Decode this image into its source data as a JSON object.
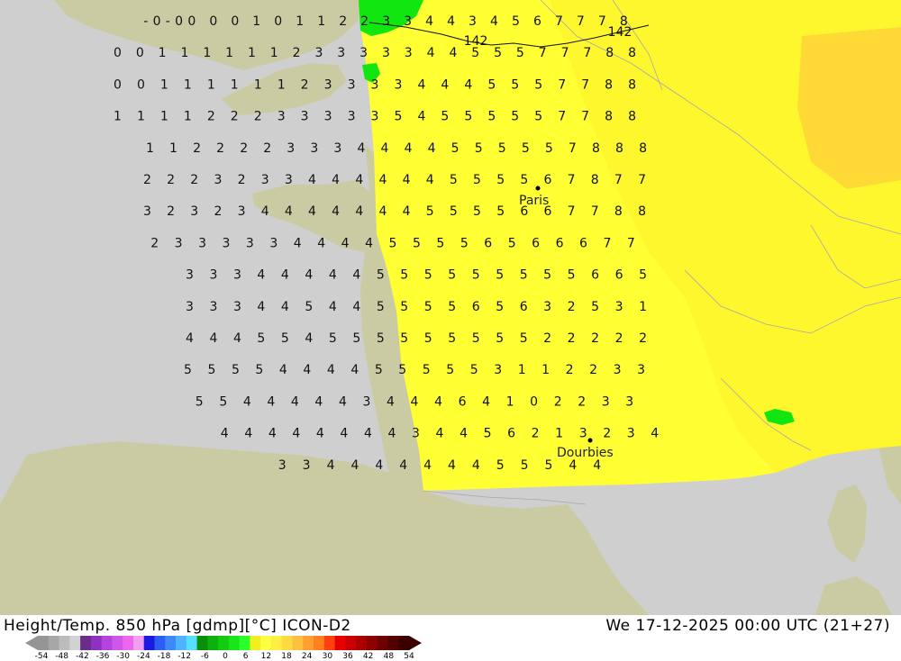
{
  "header": {
    "title_left": "Height/Temp. 850 hPa [gdmp][°C] ICON-D2",
    "title_right": "We 17-12-2025 00:00 UTC (21+27)"
  },
  "colors": {
    "sea": "#cfcfcf",
    "land": "#cbcba3",
    "field_yellow": "#ffff33",
    "field_yellow_warm": "#fff02a",
    "field_orange": "#ffd935",
    "field_green": "#11e611"
  },
  "legend": {
    "ticks": [
      "-54",
      "-48",
      "-42",
      "-36",
      "-30",
      "-24",
      "-18",
      "-12",
      "-6",
      "0",
      "6",
      "12",
      "18",
      "24",
      "30",
      "36",
      "42",
      "48",
      "54"
    ],
    "swatches": [
      "#959595",
      "#a7a7a7",
      "#bcbcbc",
      "#d2d2d2",
      "#6b2d8c",
      "#9030c0",
      "#b444dd",
      "#d056ea",
      "#ee66ee",
      "#f0a0f0",
      "#1a1ae0",
      "#2f5cf4",
      "#3f88f8",
      "#4fb3ff",
      "#55e0ff",
      "#0a8f0a",
      "#0db00d",
      "#11cc11",
      "#19e619",
      "#2cff2c",
      "#f0f020",
      "#ffff44",
      "#ffee44",
      "#ffd940",
      "#ffc040",
      "#ffa030",
      "#ff8020",
      "#ff4010",
      "#e60000",
      "#c80000",
      "#aa0000",
      "#8c0000",
      "#6e0000",
      "#520000",
      "#3a0000"
    ]
  },
  "places": [
    {
      "name": "Paris"
    },
    {
      "name": "Dourbies"
    }
  ],
  "contours": [
    {
      "label": "142"
    },
    {
      "label": "142"
    }
  ],
  "grid_values": [
    "-0-00 0 0 1 0 1 1 2 2 3 3 4 4 3 4 5 6 7 7 7 8",
    "0 0 1 1 1 1 1 1 2 3 3 3 3 3 4 4 5 5 5 7 7 7 8 8",
    "0 0 1 1 1 1 1 1 2 3 3 3 3 4 4 4 5 5 5 7 7 8 8",
    "1 1 1 1 2 2 2 3 3 3 3 3 5 4 5 5 5 5 5 7 7 8 8",
    "1 1 2 2 2 2 3 3 3 4 4 4 4 5 5 5 5 5 7 8 8 8",
    "2 2 2 3 2 3 3 4 4 4 4 4 4 5 5 5 5 6 7 8 7 7",
    "3 2 3 2 3 4 4 4 4 4 4 4 5 5 5 5 6 6 7 7 8 8",
    "2 3 3 3 3 3 4 4 4 4 5 5 5 5 6 5 6 6 6 7 7",
    "3 3 3 4 4 4 4 4 5 5 5 5 5 5 5 5 5 6 6 5",
    "3 3 3 4 4 5 4 4 5 5 5 5 6 5 6 3 2 5 3 1",
    "4 4 4 5 5 4 5 5 5 5 5 5 5 5 5 2 2 2 2 2",
    "5 5 5 5 4 4 4 4 5 5 5 5 5 3 1 1 2 2 3 3",
    "5 5 4 4 4 4 4 3 4 4 4 6 4 1 0 2 2 3 3",
    "4 4 4 4 4 4 4 4 3 4 4 5 6 2 1 3 2 3 4",
    "3 3 4 4 4 4 4 4 4 5 5 5 4 4"
  ]
}
